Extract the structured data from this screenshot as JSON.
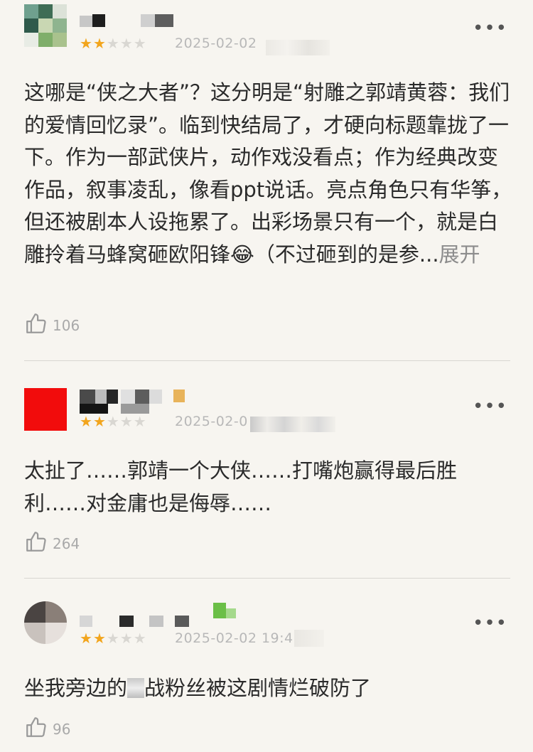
{
  "reviews": [
    {
      "rating": 2,
      "date": "2025-02-02",
      "text": "这哪是“侠之大者”？这分明是“射雕之郭靖黄蓉：我们的爱情回忆录”。临到快结局了，才硬向标题靠拢了一下。作为一部武侠片，动作戏没看点；作为经典改变作品，叙事凌乱，像看ppt说话。亮点角色只有华筝，但还被剧本人设拖累了。出彩场景只有一个，就是白雕拎着马蜂窝砸欧阳锋😂（不过砸到的是参...",
      "expand_label": "展开",
      "likes": "106"
    },
    {
      "rating": 2,
      "date": "2025-02-0",
      "text": "太扯了……郭靖一个大侠……打嘴炮赢得最后胜利……对金庸也是侮辱……",
      "likes": "264"
    },
    {
      "rating": 2,
      "date": "2025-02-02 19:4",
      "text": "坐我旁边的",
      "text_after": "战粉丝被这剧情烂破防了",
      "likes": "96"
    }
  ],
  "more_label": "•••",
  "stars": {
    "on": "★",
    "off": "★"
  },
  "colors": {
    "star_on": "#f2a51d",
    "star_off": "#d9d7d2",
    "background": "#f7f5f0"
  },
  "icons": {
    "like": "thumbs-up-icon",
    "more": "more-dots-icon"
  }
}
